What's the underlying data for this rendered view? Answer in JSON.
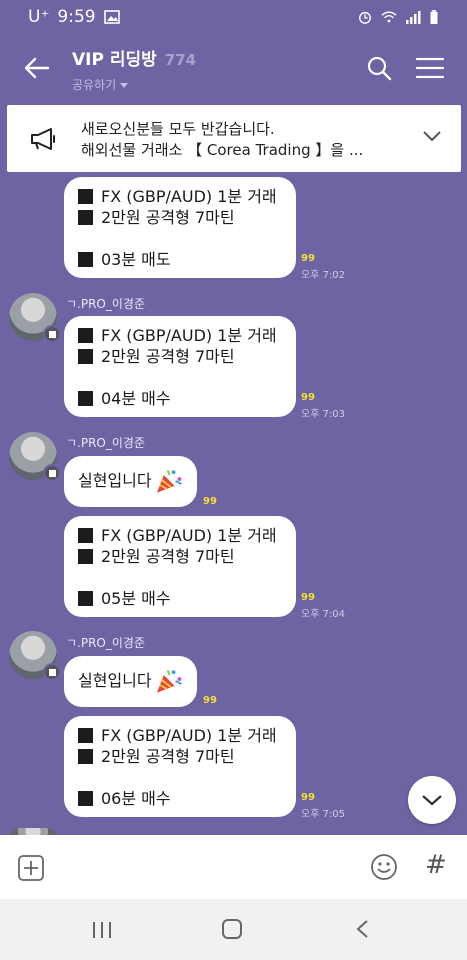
{
  "status_bar": {
    "carrier": "U⁺",
    "time": "9:59"
  },
  "header": {
    "title": "VIP 리딩방",
    "member_count": "774",
    "share_label": "공유하기"
  },
  "notice": {
    "line1": "새로오신분들 모두 반갑습니다.",
    "line2": "해외선물 거래소 【 Corea Trading 】을 ..."
  },
  "messages": [
    {
      "lines": [
        "FX (GBP/AUD) 1분 거래",
        "2만원 공격형 7마틴",
        "03분 매도"
      ],
      "unread": "99",
      "time": "오후 7:02"
    },
    {
      "sender": "ㄱ.PRO_이경준",
      "lines": [
        "FX (GBP/AUD) 1분 거래",
        "2만원 공격형 7마틴",
        "04분 매수"
      ],
      "unread": "99",
      "time": "오후 7:03"
    },
    {
      "sender": "ㄱ.PRO_이경준",
      "text": "실현입니다",
      "unread": "99"
    },
    {
      "lines": [
        "FX (GBP/AUD) 1분 거래",
        "2만원 공격형 7마틴",
        "05분 매수"
      ],
      "unread": "99",
      "time": "오후 7:04"
    },
    {
      "sender": "ㄱ.PRO_이경준",
      "text": "실현입니다",
      "unread": "99"
    },
    {
      "lines": [
        "FX (GBP/AUD) 1분 거래",
        "2만원 공격형 7마틴",
        "06분 매수"
      ],
      "unread": "99",
      "time": "오후 7:05"
    }
  ],
  "input": {
    "hash": "#"
  },
  "colors": {
    "chat_background": "#6e63a3",
    "unread": "#f5e03b"
  }
}
